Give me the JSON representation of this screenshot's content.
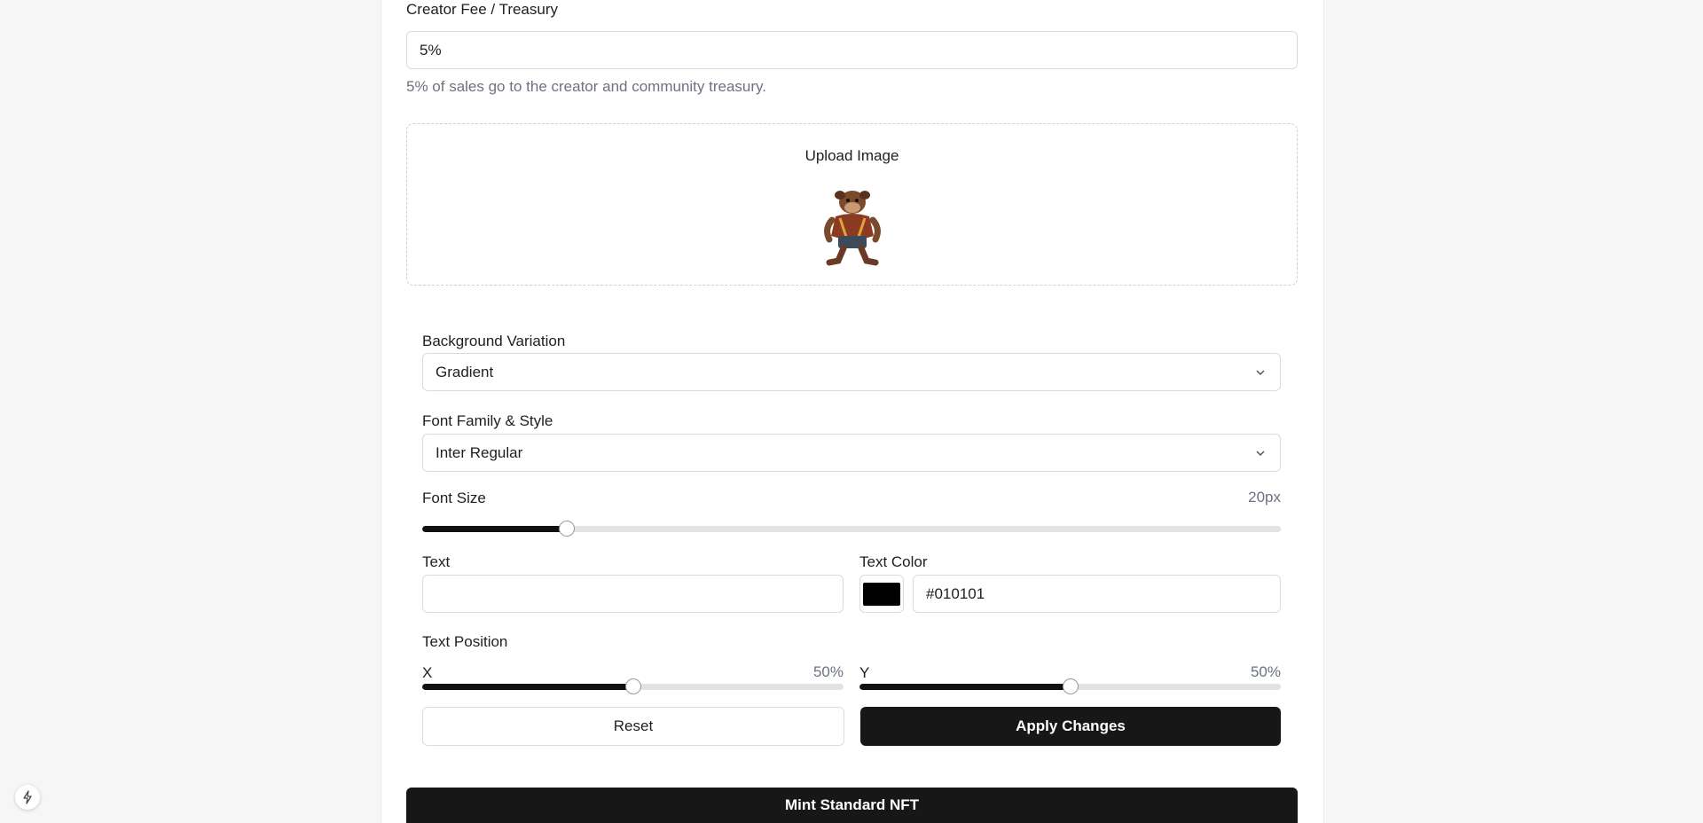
{
  "creator_fee": {
    "label": "Creator Fee / Treasury",
    "value": "5%",
    "help": "5% of sales go to the creator and community treasury."
  },
  "upload": {
    "title": "Upload Image",
    "image_alt": "bulldog character"
  },
  "background_variation": {
    "label": "Background Variation",
    "selected": "Gradient"
  },
  "font_family": {
    "label": "Font Family & Style",
    "selected": "Inter Regular"
  },
  "font_size": {
    "label": "Font Size",
    "value_text": "20px",
    "fraction": 0.168
  },
  "text": {
    "label": "Text",
    "value": ""
  },
  "text_color": {
    "label": "Text Color",
    "value": "#010101",
    "swatch": "#010101"
  },
  "text_position": {
    "label": "Text Position",
    "x": {
      "label": "X",
      "value_text": "50%",
      "fraction": 0.5
    },
    "y": {
      "label": "Y",
      "value_text": "50%",
      "fraction": 0.5
    }
  },
  "buttons": {
    "reset": "Reset",
    "apply": "Apply Changes",
    "mint": "Mint Standard NFT"
  },
  "fab": {
    "icon": "bolt-icon"
  }
}
